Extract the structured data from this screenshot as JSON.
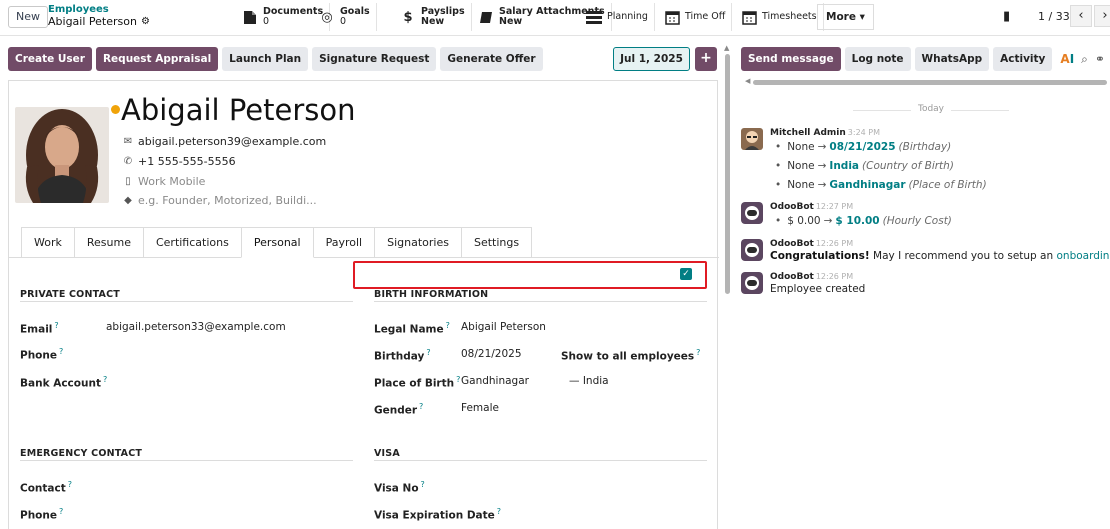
{
  "topbar": {
    "new_label": "New",
    "breadcrumb_parent": "Employees",
    "breadcrumb_current": "Abigail Peterson",
    "smart_buttons": [
      {
        "name": "documents",
        "label": "Documents",
        "value": "0",
        "icon": "document-icon"
      },
      {
        "name": "goals",
        "label": "Goals",
        "value": "0",
        "icon": "target-icon"
      },
      {
        "name": "payslips",
        "label": "Payslips",
        "value": "New",
        "icon": "dollar-icon"
      },
      {
        "name": "salary-attachments",
        "label": "Salary Attachments",
        "value": "New",
        "icon": "book-icon"
      },
      {
        "name": "planning",
        "label": "Planning",
        "value": "",
        "icon": "planning-icon"
      },
      {
        "name": "time-off",
        "label": "Time Off",
        "value": "",
        "icon": "calendar-icon"
      },
      {
        "name": "timesheets",
        "label": "Timesheets",
        "value": "",
        "icon": "calendar-icon"
      }
    ],
    "more_label": "More ▾",
    "pager": "1 / 33"
  },
  "actions": {
    "create_user": "Create User",
    "request_appraisal": "Request Appraisal",
    "launch_plan": "Launch Plan",
    "signature_request": "Signature Request",
    "generate_offer": "Generate Offer",
    "date": "Jul 1, 2025",
    "plus": "+"
  },
  "employee": {
    "name": "Abigail Peterson",
    "email": "abigail.peterson39@example.com",
    "phone": "+1 555-555-5556",
    "mobile_placeholder": "Work Mobile",
    "tags_placeholder": "e.g. Founder, Motorized, Buildi..."
  },
  "tabs": [
    "Work",
    "Resume",
    "Certifications",
    "Personal",
    "Payroll",
    "Signatories",
    "Settings"
  ],
  "personal": {
    "private_contact_title": "PRIVATE CONTACT",
    "email_label": "Email",
    "email_value": "abigail.peterson33@example.com",
    "phone_label": "Phone",
    "bank_label": "Bank Account",
    "emergency_title": "EMERGENCY CONTACT",
    "contact_label": "Contact",
    "emergency_phone_label": "Phone",
    "birth_title": "BIRTH INFORMATION",
    "legal_name_label": "Legal Name",
    "legal_name_value": "Abigail Peterson",
    "birthday_label": "Birthday",
    "birthday_value": "08/21/2025",
    "show_all_label": "Show to all employees",
    "show_all_checked": true,
    "place_label": "Place of Birth",
    "place_value": "Gandhinagar",
    "country_value": "— India",
    "gender_label": "Gender",
    "gender_value": "Female",
    "visa_title": "VISA",
    "visa_no_label": "Visa No",
    "visa_exp_label": "Visa Expiration Date"
  },
  "chatter": {
    "send_message": "Send message",
    "log_note": "Log note",
    "whatsapp": "WhatsApp",
    "activity": "Activity",
    "today": "Today",
    "messages": [
      {
        "author": "Mitchell Admin",
        "time": "3:24 PM",
        "changes": [
          {
            "old": "None",
            "new": "08/21/2025",
            "field": "(Birthday)"
          },
          {
            "old": "None",
            "new": "India",
            "field": "(Country of Birth)"
          },
          {
            "old": "None",
            "new": "Gandhinagar",
            "field": "(Place of Birth)"
          }
        ]
      },
      {
        "author": "OdooBot",
        "time": "12:27 PM",
        "changes": [
          {
            "old": "$ 0.00",
            "new": "$ 10.00",
            "field": "(Hourly Cost)"
          }
        ]
      },
      {
        "author": "OdooBot",
        "time": "12:26 PM",
        "body_bold": "Congratulations!",
        "body": " May I recommend you to setup an ",
        "body_link": "onboarding plan?"
      },
      {
        "author": "OdooBot",
        "time": "12:26 PM",
        "body": "Employee created"
      }
    ]
  },
  "colors": {
    "brand": "#714b67",
    "accent": "#017e84",
    "highlight": "#e01b24",
    "presence": "#f0a30a"
  }
}
